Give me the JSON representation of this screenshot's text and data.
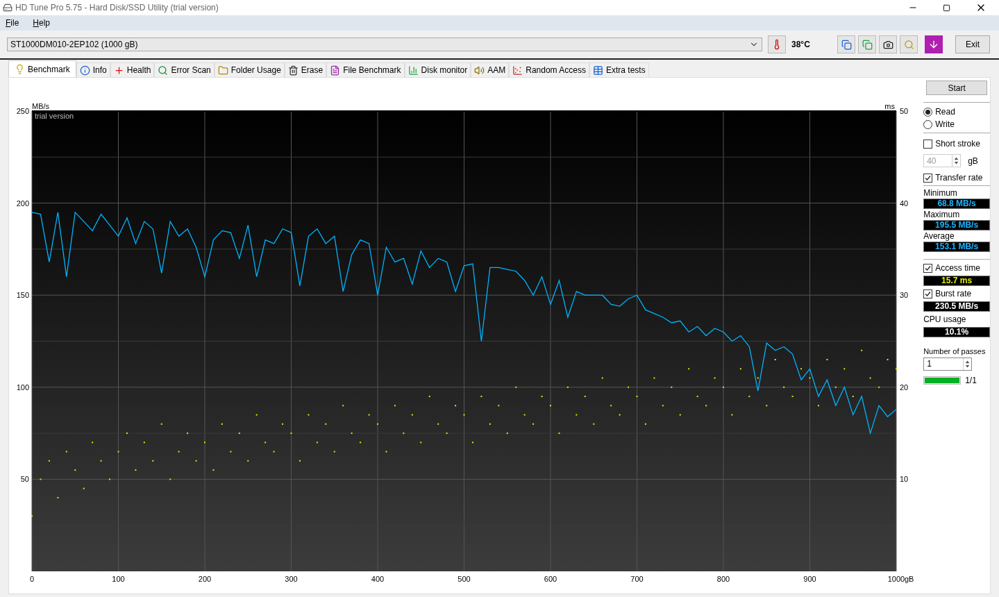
{
  "window": {
    "title": "HD Tune Pro 5.75 - Hard Disk/SSD Utility (trial version)"
  },
  "menu": [
    {
      "label": "File"
    },
    {
      "label": "Help"
    }
  ],
  "toolbar": {
    "drive": "ST1000DM010-2EP102 (1000 gB)",
    "temperature": "38°C",
    "exit": "Exit"
  },
  "tabs": [
    {
      "label": "Benchmark",
      "selected": true
    },
    {
      "label": "Info",
      "selected": false
    },
    {
      "label": "Health",
      "selected": false
    },
    {
      "label": "Error Scan",
      "selected": false
    },
    {
      "label": "Folder Usage",
      "selected": false
    },
    {
      "label": "Erase",
      "selected": false
    },
    {
      "label": "File Benchmark",
      "selected": false
    },
    {
      "label": "Disk monitor",
      "selected": false
    },
    {
      "label": "AAM",
      "selected": false
    },
    {
      "label": "Random Access",
      "selected": false
    },
    {
      "label": "Extra tests",
      "selected": false
    }
  ],
  "chart": {
    "watermark": "trial version",
    "chart_data": {
      "type": "line",
      "grid": true,
      "xlabel": "gB",
      "ylabel": "MB/s",
      "y2label": "ms",
      "xlim": [
        0,
        1000
      ],
      "ylim": [
        0,
        250
      ],
      "y2lim": [
        0,
        50
      ],
      "xticks": [
        0,
        100,
        200,
        300,
        400,
        500,
        600,
        700,
        800,
        900,
        1000
      ],
      "yticks": [
        50,
        100,
        150,
        200,
        250
      ],
      "y2ticks": [
        10,
        20,
        30,
        40,
        50
      ],
      "x": [
        0,
        10,
        20,
        30,
        40,
        50,
        60,
        70,
        80,
        90,
        100,
        110,
        120,
        130,
        140,
        150,
        160,
        170,
        180,
        190,
        200,
        210,
        220,
        230,
        240,
        250,
        260,
        270,
        280,
        290,
        300,
        310,
        320,
        330,
        340,
        350,
        360,
        370,
        380,
        390,
        400,
        410,
        420,
        430,
        440,
        450,
        460,
        470,
        480,
        490,
        500,
        510,
        520,
        530,
        540,
        550,
        560,
        570,
        580,
        590,
        600,
        610,
        620,
        630,
        640,
        650,
        660,
        670,
        680,
        690,
        700,
        710,
        720,
        730,
        740,
        750,
        760,
        770,
        780,
        790,
        800,
        810,
        820,
        830,
        840,
        850,
        860,
        870,
        880,
        890,
        900,
        910,
        920,
        930,
        940,
        950,
        960,
        970,
        980,
        990,
        1000
      ],
      "series": [
        {
          "color": "#00b4ff",
          "values": [
            195,
            194,
            168,
            195,
            160,
            195,
            190,
            185,
            194,
            188,
            182,
            192,
            178,
            190,
            186,
            162,
            190,
            182,
            186,
            176,
            160,
            180,
            185,
            184,
            170,
            188,
            160,
            180,
            178,
            186,
            184,
            155,
            182,
            186,
            178,
            182,
            152,
            172,
            180,
            178,
            150,
            176,
            168,
            170,
            156,
            174,
            165,
            170,
            168,
            152,
            166,
            167,
            125,
            165,
            165,
            164,
            163,
            158,
            150,
            160,
            145,
            158,
            138,
            152,
            150,
            150,
            150,
            145,
            144,
            148,
            150,
            142,
            140,
            138,
            135,
            136,
            130,
            133,
            128,
            132,
            130,
            125,
            128,
            122,
            98,
            124,
            120,
            122,
            118,
            104,
            110,
            95,
            104,
            90,
            100,
            85,
            95,
            75,
            90,
            84,
            88
          ]
        },
        {
          "color": "#e6e600",
          "axis": "y2",
          "type": "scatter",
          "values": [
            6,
            10,
            12,
            8,
            13,
            11,
            9,
            14,
            12,
            10,
            13,
            15,
            11,
            14,
            12,
            16,
            10,
            13,
            15,
            12,
            14,
            11,
            16,
            13,
            15,
            12,
            17,
            14,
            13,
            16,
            15,
            12,
            17,
            14,
            16,
            13,
            18,
            15,
            14,
            17,
            16,
            13,
            18,
            15,
            17,
            14,
            19,
            16,
            15,
            18,
            17,
            14,
            19,
            16,
            18,
            15,
            20,
            17,
            16,
            19,
            18,
            15,
            20,
            17,
            19,
            16,
            21,
            18,
            17,
            20,
            19,
            16,
            21,
            18,
            20,
            17,
            22,
            19,
            18,
            21,
            20,
            17,
            22,
            19,
            21,
            18,
            23,
            20,
            19,
            22,
            21,
            18,
            23,
            20,
            22,
            19,
            24,
            21,
            20,
            23,
            22
          ]
        }
      ]
    }
  },
  "side": {
    "start": "Start",
    "modes": [
      {
        "label": "Read",
        "selected": true
      },
      {
        "label": "Write",
        "selected": false
      }
    ],
    "short_stroke": {
      "label": "Short stroke",
      "checked": false,
      "value": "40",
      "disabled": true,
      "unit": "gB"
    },
    "transfer_rate": {
      "label": "Transfer rate",
      "checked": true
    },
    "readouts": [
      {
        "label": "Minimum",
        "value": "68.8 MB/s"
      },
      {
        "label": "Maximum",
        "value": "195.5 MB/s"
      },
      {
        "label": "Average",
        "value": "153.1 MB/s"
      }
    ],
    "access_time": {
      "label": "Access time",
      "checked": true,
      "value": "15.7 ms"
    },
    "burst_rate": {
      "label": "Burst rate",
      "checked": true,
      "value": "230.5 MB/s"
    },
    "cpu": {
      "label": "CPU usage",
      "value": "10.1%"
    },
    "passes": {
      "label": "Number of passes",
      "value": "1",
      "level": 1,
      "reading": "1/1"
    }
  }
}
